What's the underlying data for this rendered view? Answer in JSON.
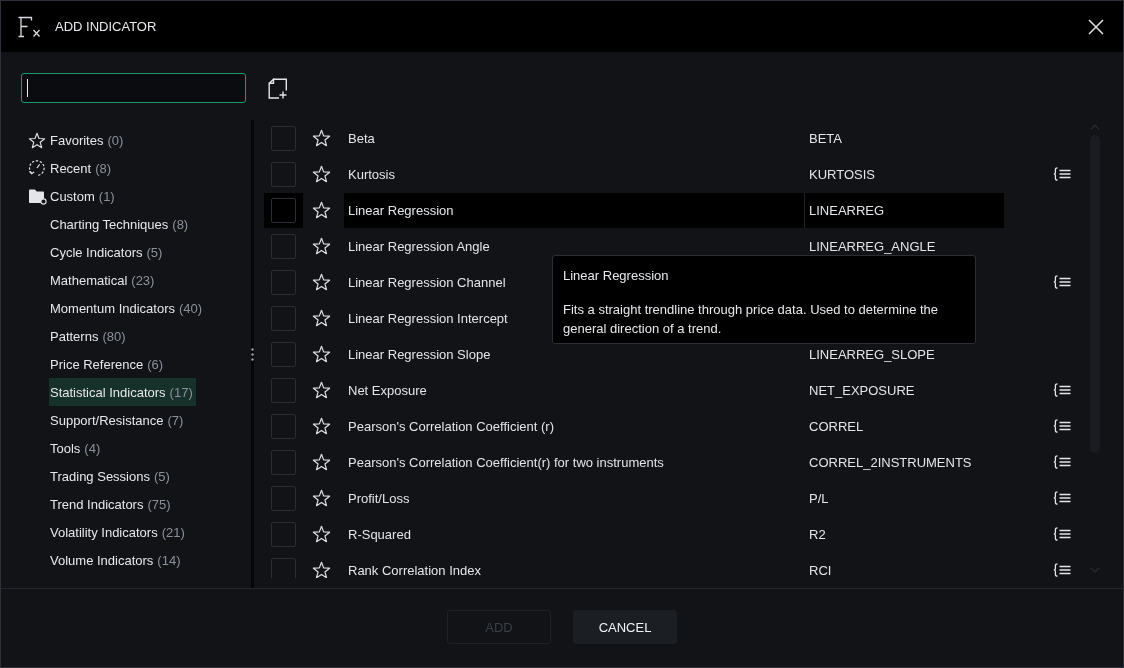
{
  "window": {
    "title": "ADD INDICATOR"
  },
  "search": {
    "focused": true
  },
  "sidebar": {
    "items": [
      {
        "kind": "favorites",
        "label": "Favorites",
        "count": "(0)",
        "selected": false
      },
      {
        "kind": "recent",
        "label": "Recent",
        "count": "(8)",
        "selected": false
      },
      {
        "kind": "custom",
        "label": "Custom",
        "count": "(1)",
        "selected": false
      },
      {
        "kind": "category",
        "label": "Charting Techniques",
        "count": "(8)",
        "selected": false
      },
      {
        "kind": "category",
        "label": "Cycle Indicators",
        "count": "(5)",
        "selected": false
      },
      {
        "kind": "category",
        "label": "Mathematical",
        "count": "(23)",
        "selected": false
      },
      {
        "kind": "category",
        "label": "Momentum Indicators",
        "count": "(40)",
        "selected": false
      },
      {
        "kind": "category",
        "label": "Patterns",
        "count": "(80)",
        "selected": false
      },
      {
        "kind": "category",
        "label": "Price Reference",
        "count": "(6)",
        "selected": false
      },
      {
        "kind": "category",
        "label": "Statistical Indicators",
        "count": "(17)",
        "selected": true
      },
      {
        "kind": "category",
        "label": "Support/Resistance",
        "count": "(7)",
        "selected": false
      },
      {
        "kind": "category",
        "label": "Tools",
        "count": "(4)",
        "selected": false
      },
      {
        "kind": "category",
        "label": "Trading Sessions",
        "count": "(5)",
        "selected": false
      },
      {
        "kind": "category",
        "label": "Trend Indicators",
        "count": "(75)",
        "selected": false
      },
      {
        "kind": "category",
        "label": "Volatility Indicators",
        "count": "(21)",
        "selected": false
      },
      {
        "kind": "category",
        "label": "Volume Indicators",
        "count": "(14)",
        "selected": false
      }
    ]
  },
  "indicators": {
    "rows": [
      {
        "name": "Beta",
        "code": "BETA",
        "checked": false,
        "favorite": false,
        "has_formula": false,
        "highlighted": false
      },
      {
        "name": "Kurtosis",
        "code": "KURTOSIS",
        "checked": false,
        "favorite": false,
        "has_formula": true,
        "highlighted": false
      },
      {
        "name": "Linear Regression",
        "code": "LINEARREG",
        "checked": false,
        "favorite": false,
        "has_formula": false,
        "highlighted": true
      },
      {
        "name": "Linear Regression Angle",
        "code": "LINEARREG_ANGLE",
        "checked": false,
        "favorite": false,
        "has_formula": false,
        "highlighted": false
      },
      {
        "name": "Linear Regression Channel",
        "checked": false,
        "favorite": false,
        "has_formula": true,
        "highlighted": false
      },
      {
        "name": "Linear Regression Intercept",
        "checked": false,
        "favorite": false,
        "has_formula": false,
        "highlighted": false
      },
      {
        "name": "Linear Regression Slope",
        "code": "LINEARREG_SLOPE",
        "checked": false,
        "favorite": false,
        "has_formula": false,
        "highlighted": false
      },
      {
        "name": "Net Exposure",
        "code": "NET_EXPOSURE",
        "checked": false,
        "favorite": false,
        "has_formula": true,
        "highlighted": false
      },
      {
        "name": "Pearson's Correlation Coefficient (r)",
        "code": "CORREL",
        "checked": false,
        "favorite": false,
        "has_formula": true,
        "highlighted": false
      },
      {
        "name": "Pearson's Correlation Coefficient(r) for two instruments",
        "code": "CORREL_2INSTRUMENTS",
        "checked": false,
        "favorite": false,
        "has_formula": true,
        "highlighted": false
      },
      {
        "name": "Profit/Loss",
        "code": "P/L",
        "checked": false,
        "favorite": false,
        "has_formula": true,
        "highlighted": false
      },
      {
        "name": "R-Squared",
        "code": "R2",
        "checked": false,
        "favorite": false,
        "has_formula": true,
        "highlighted": false
      },
      {
        "name": "Rank Correlation Index",
        "code": "RCI",
        "checked": false,
        "favorite": false,
        "has_formula": true,
        "highlighted": false
      }
    ]
  },
  "tooltip": {
    "title": "Linear Regression",
    "description": "Fits a straight trendline through price data. Used to determine the general direction of a trend."
  },
  "buttons": [
    {
      "label": "ADD",
      "disabled": true
    },
    {
      "label": "CANCEL",
      "disabled": false
    }
  ]
}
